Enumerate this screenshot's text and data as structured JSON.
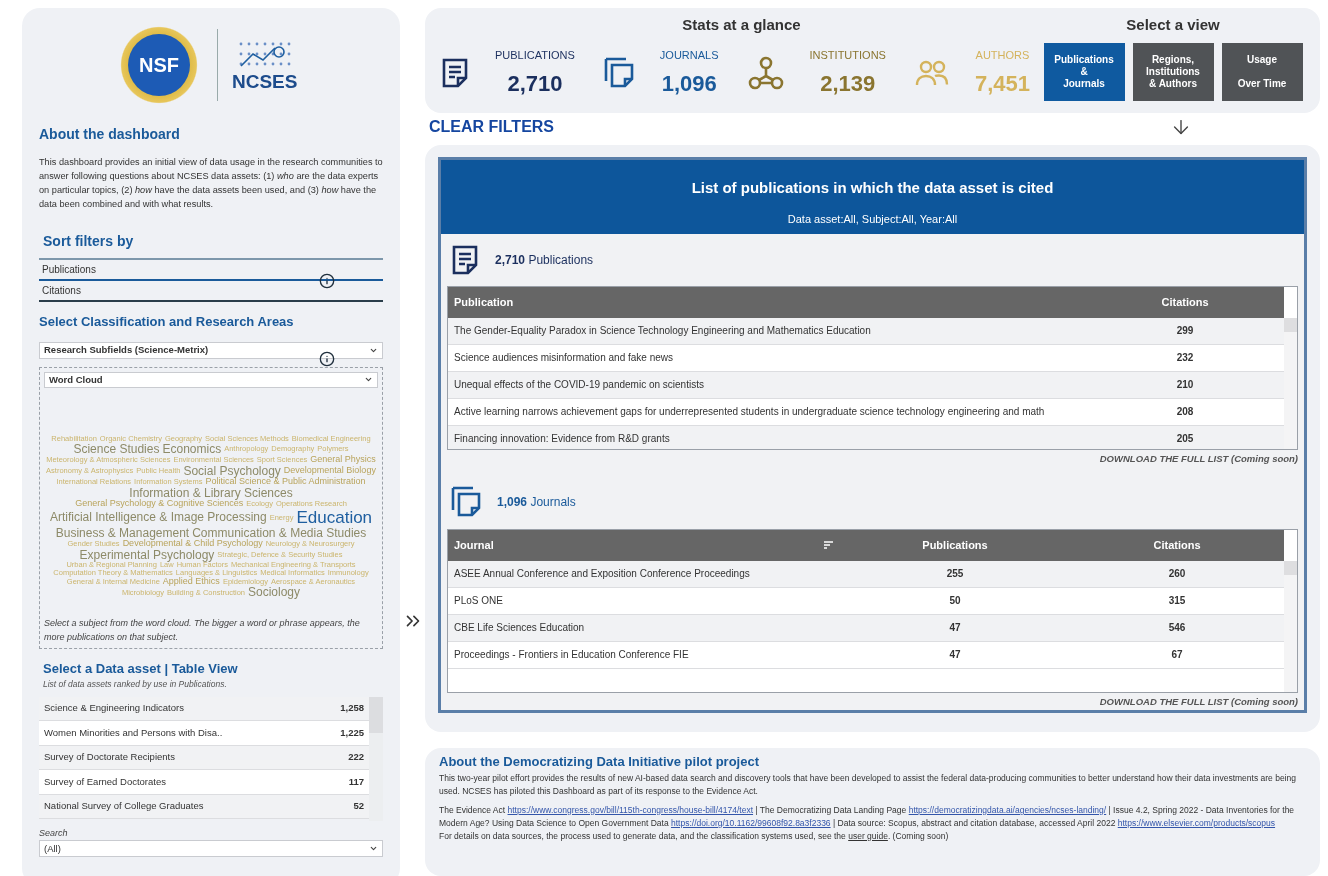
{
  "logos": {
    "nsf": "NSF",
    "ncses": "NCSES"
  },
  "about": {
    "title": "About the dashboard",
    "text": "This dashboard provides an initial view of data usage in the research communities to answer following questions about NCSES data assets: (1) *who* are the data experts on particular topics, (2) *how* have the data assets been used, and (3) *how* have the data been combined and with what results."
  },
  "sort_filters": {
    "title": "Sort filters by",
    "options": [
      {
        "label": "Publications",
        "selected": true
      },
      {
        "label": "Citations",
        "selected": false
      }
    ]
  },
  "classification": {
    "title": "Select Classification and Research Areas",
    "dropdown": "Research Subfields (Science-Metrix)",
    "view_dropdown": "Word Cloud",
    "hint": "Select a subject from the word cloud. The bigger a word or phrase appears, the more publications on that subject.",
    "words": [
      {
        "text": "Rehabilitation",
        "kind": "small"
      },
      {
        "text": "Organic Chemistry",
        "kind": "small"
      },
      {
        "text": "Geography",
        "kind": "small"
      },
      {
        "text": "Social Sciences Methods",
        "kind": "small"
      },
      {
        "text": "Biomedical Engineering",
        "kind": "small"
      },
      {
        "text": "Science Studies",
        "kind": "large"
      },
      {
        "text": "Economics",
        "kind": "large"
      },
      {
        "text": "Anthropology",
        "kind": "small"
      },
      {
        "text": "Demography",
        "kind": "small"
      },
      {
        "text": "Polymers",
        "kind": "small"
      },
      {
        "text": "Meteorology & Atmospheric Sciences",
        "kind": "small"
      },
      {
        "text": "Environmental Sciences",
        "kind": "small"
      },
      {
        "text": "Sport Sciences",
        "kind": "small"
      },
      {
        "text": "General Physics",
        "kind": "medium"
      },
      {
        "text": "Astronomy & Astrophysics",
        "kind": "small"
      },
      {
        "text": "Public Health",
        "kind": "small"
      },
      {
        "text": "Social Psychology",
        "kind": "large"
      },
      {
        "text": "Developmental Biology",
        "kind": "medium"
      },
      {
        "text": "International Relations",
        "kind": "small"
      },
      {
        "text": "Information Systems",
        "kind": "small"
      },
      {
        "text": "Political Science & Public Administration",
        "kind": "medium"
      },
      {
        "text": "Information & Library Sciences",
        "kind": "large"
      },
      {
        "text": "General Psychology & Cognitive Sciences",
        "kind": "medium"
      },
      {
        "text": "Ecology",
        "kind": "small"
      },
      {
        "text": "Operations Research",
        "kind": "small"
      },
      {
        "text": "Artificial Intelligence & Image Processing",
        "kind": "large"
      },
      {
        "text": "Energy",
        "kind": "small"
      },
      {
        "text": "Education",
        "kind": "top"
      },
      {
        "text": "Business & Management",
        "kind": "large"
      },
      {
        "text": "Communication & Media Studies",
        "kind": "large"
      },
      {
        "text": "Gender Studies",
        "kind": "small"
      },
      {
        "text": "Developmental & Child Psychology",
        "kind": "medium"
      },
      {
        "text": "Neurology & Neurosurgery",
        "kind": "small"
      },
      {
        "text": "Experimental Psychology",
        "kind": "large"
      },
      {
        "text": "Strategic, Defence & Security Studies",
        "kind": "small"
      },
      {
        "text": "Urban & Regional Planning",
        "kind": "small"
      },
      {
        "text": "Law",
        "kind": "small"
      },
      {
        "text": "Human Factors",
        "kind": "small"
      },
      {
        "text": "Mechanical Engineering & Transports",
        "kind": "small"
      },
      {
        "text": "Computation Theory & Mathematics",
        "kind": "small"
      },
      {
        "text": "Languages & Linguistics",
        "kind": "small"
      },
      {
        "text": "Medical Informatics",
        "kind": "small"
      },
      {
        "text": "Immunology",
        "kind": "small"
      },
      {
        "text": "General & Internal Medicine",
        "kind": "small"
      },
      {
        "text": "Applied Ethics",
        "kind": "medium"
      },
      {
        "text": "Epidemiology",
        "kind": "small"
      },
      {
        "text": "Aerospace & Aeronautics",
        "kind": "small"
      },
      {
        "text": "Microbiology",
        "kind": "small"
      },
      {
        "text": "Building & Construction",
        "kind": "small"
      },
      {
        "text": "Sociology",
        "kind": "large"
      }
    ]
  },
  "data_asset": {
    "title": "Select a Data asset | Table View",
    "subtitle": "List of data assets ranked by use in Publications.",
    "rows": [
      {
        "name": "Science & Engineering Indicators",
        "count": "1,258"
      },
      {
        "name": "Women Minorities and Persons with Disa..",
        "count": "1,225"
      },
      {
        "name": "Survey of Doctorate Recipients",
        "count": "222"
      },
      {
        "name": "Survey of Earned Doctorates",
        "count": "117"
      },
      {
        "name": "National Survey of College Graduates",
        "count": "52"
      }
    ],
    "search_label": "Search",
    "search_value": "(All)"
  },
  "stats": {
    "title": "Stats at a glance",
    "items": [
      {
        "kind": "publications",
        "label": "PUBLICATIONS",
        "value": "2,710",
        "color": "#1b2f5e"
      },
      {
        "kind": "journals",
        "label": "JOURNALS",
        "value": "1,096",
        "color": "#1a5a9a"
      },
      {
        "kind": "institutions",
        "label": "INSTITUTIONS",
        "value": "2,139",
        "color": "#8a7530"
      },
      {
        "kind": "authors",
        "label": "AUTHORS",
        "value": "7,451",
        "color": "#d4b35c"
      }
    ]
  },
  "views": {
    "title": "Select a view",
    "buttons": [
      {
        "lines": [
          "Publications",
          "&",
          "Journals"
        ],
        "selected": true
      },
      {
        "lines": [
          "Regions,",
          "Institutions",
          "& Authors"
        ],
        "selected": false
      },
      {
        "lines": [
          "Usage",
          "Over Time"
        ],
        "selected": false
      }
    ]
  },
  "clear_filters": "CLEAR FILTERS",
  "panel": {
    "title": "List of publications in which the data asset is cited",
    "subtitle": "Data asset:All, Subject:All, Year:All",
    "publications": {
      "count": "2,710",
      "label": "Publications",
      "columns": [
        "Publication",
        "Citations"
      ],
      "rows": [
        [
          "The Gender-Equality Paradox in Science Technology Engineering and Mathematics Education",
          "299"
        ],
        [
          "Science audiences misinformation and fake news",
          "232"
        ],
        [
          "Unequal effects of the COVID-19 pandemic on scientists",
          "210"
        ],
        [
          "Active learning narrows achievement gaps for underrepresented students in undergraduate science technology engineering and math",
          "208"
        ],
        [
          "Financing innovation: Evidence from R&D grants",
          "205"
        ]
      ],
      "download": "DOWNLOAD THE FULL LIST (Coming soon)"
    },
    "journals": {
      "count": "1,096",
      "label": "Journals",
      "columns": [
        "Journal",
        "Publications",
        "Citations"
      ],
      "rows": [
        [
          "ASEE Annual Conference and Exposition Conference Proceedings",
          "255",
          "260"
        ],
        [
          "PLoS ONE",
          "50",
          "315"
        ],
        [
          "CBE Life Sciences Education",
          "47",
          "546"
        ],
        [
          "Proceedings - Frontiers in Education Conference FIE",
          "47",
          "67"
        ]
      ],
      "download": "DOWNLOAD THE FULL LIST (Coming soon)"
    }
  },
  "initiative": {
    "title": "About the Democratizing Data Initiative pilot project",
    "text": "This two-year pilot effort provides the results of new AI-based data search and discovery tools that have been developed to assist the federal data-producing communities to better understand how their data investments are being used. NCSES has piloted this Dashboard as part of its response to the Evidence Act.",
    "citation": [
      {
        "kind": "text",
        "text": "The Evidence Act "
      },
      {
        "kind": "link",
        "text": "https://www.congress.gov/bill/115th-congress/house-bill/4174/text"
      },
      {
        "kind": "text",
        "text": " | The Democratizing Data Landing Page "
      },
      {
        "kind": "link",
        "text": "https://democratizingdata.ai/agencies/ncses-landing/"
      },
      {
        "kind": "text",
        "text": " | Issue 4.2, Spring 2022 - Data Inventories for the Modern Age? Using Data Science to Open Government Data "
      },
      {
        "kind": "link",
        "text": "https://doi.org/10.1162/99608f92.8a3f2336"
      },
      {
        "kind": "text",
        "text": " | Data source: Scopus, abstract and citation database, accessed April 2022 "
      },
      {
        "kind": "link",
        "text": "https://www.elsevier.com/products/scopus"
      }
    ],
    "details": [
      {
        "kind": "text",
        "text": "For details on data sources, the process used to generate data, and the classification systems used, see the "
      },
      {
        "kind": "link",
        "text": "user guide"
      },
      {
        "kind": "text",
        "text": ". (Coming soon)"
      }
    ]
  }
}
